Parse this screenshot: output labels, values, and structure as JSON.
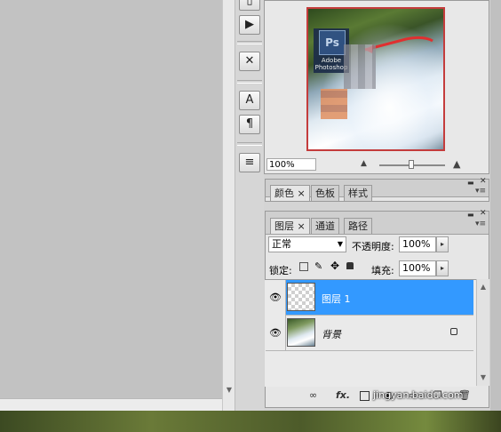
{
  "navigator": {
    "zoom_value": "100%",
    "thumb_text": "Adobe Photoshop",
    "ps_logo": "Ps"
  },
  "tools": [
    "layers-icon",
    "play-icon",
    "tools-icon",
    "text-A-icon",
    "paragraph-icon",
    "notes-icon"
  ],
  "color_panel": {
    "tabs": [
      "颜色",
      "色板",
      "样式"
    ]
  },
  "layers_panel": {
    "tabs": [
      "图层",
      "通道",
      "路径"
    ],
    "blend_mode": "正常",
    "opacity_label": "不透明度:",
    "opacity_value": "100%",
    "lock_label": "锁定:",
    "fill_label": "填充:",
    "fill_value": "100%",
    "layers": [
      {
        "name": "图层 1",
        "selected": true
      },
      {
        "name": "背景",
        "selected": false
      }
    ],
    "bottom_icons": [
      "link-icon",
      "fx-icon",
      "mask-icon",
      "adjustment-icon",
      "group-icon",
      "new-layer-icon",
      "trash-icon"
    ]
  },
  "watermark": "jingyan.baidu.com",
  "close_x": "×",
  "colors": {
    "selection": "#3399ff",
    "thumb_border": "#c43c3c"
  }
}
